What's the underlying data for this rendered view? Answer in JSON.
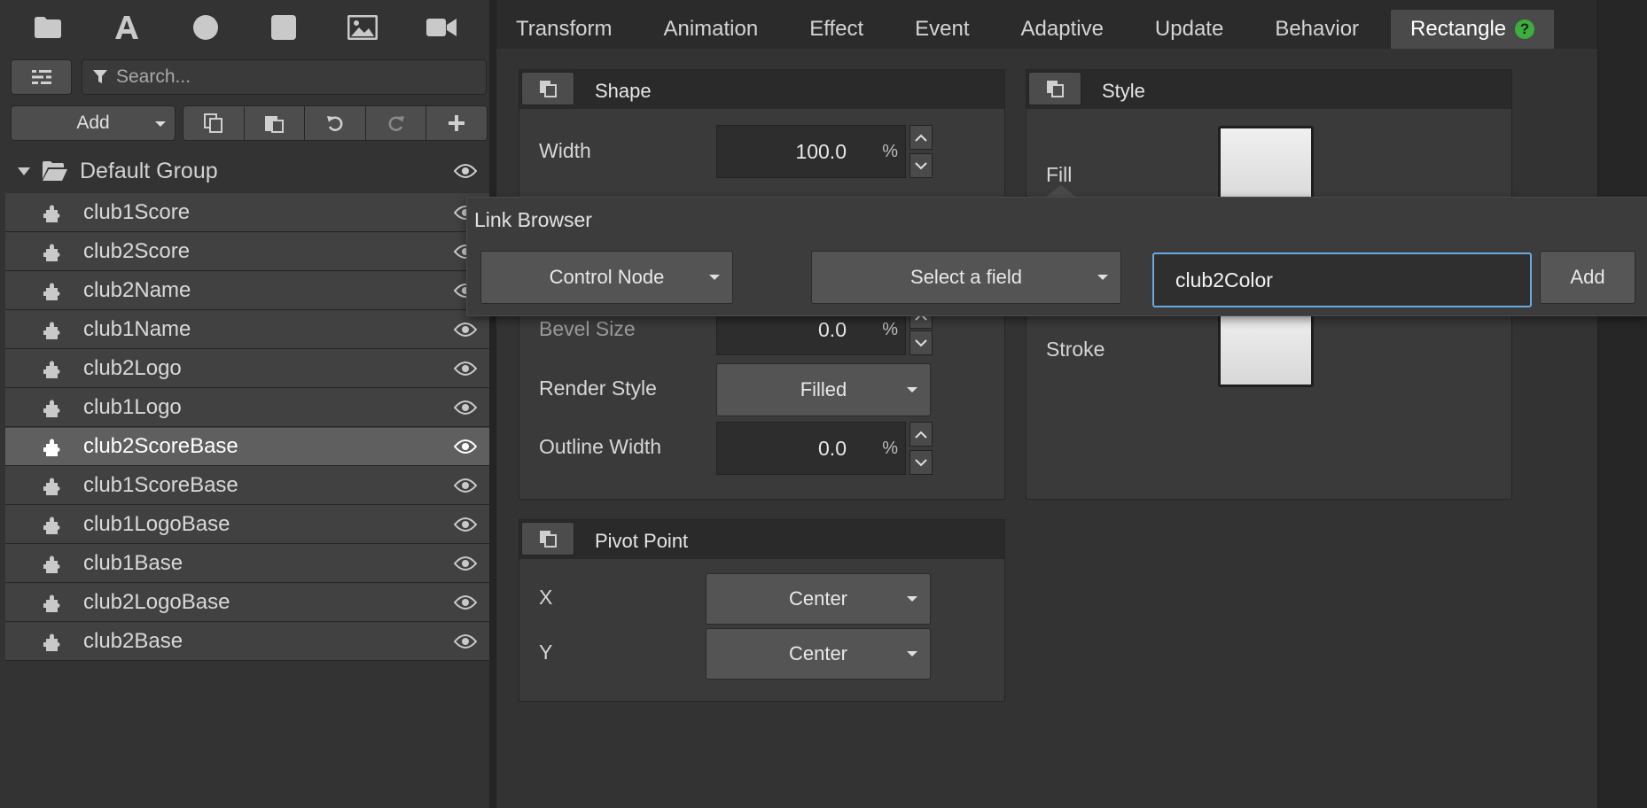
{
  "toolbar": {
    "icons": [
      "folder-icon",
      "text-icon",
      "circle-icon",
      "square-icon",
      "image-icon",
      "video-icon"
    ]
  },
  "search": {
    "placeholder": "Search..."
  },
  "controls": {
    "add_label": "Add"
  },
  "group": {
    "label": "Default Group"
  },
  "layers": [
    "club1Score",
    "club2Score",
    "club2Name",
    "club1Name",
    "club2Logo",
    "club1Logo",
    "club2ScoreBase",
    "club1ScoreBase",
    "club1LogoBase",
    "club1Base",
    "club2LogoBase",
    "club2Base"
  ],
  "selected_layer": "club2ScoreBase",
  "tabs": [
    "Transform",
    "Animation",
    "Effect",
    "Event",
    "Adaptive",
    "Update",
    "Behavior",
    "Rectangle"
  ],
  "active_tab": "Rectangle",
  "help_glyph": "?",
  "shape": {
    "title": "Shape",
    "width": {
      "label": "Width",
      "value": "100.0",
      "unit": "%"
    },
    "bevel": {
      "label": "Bevel Size",
      "value": "0.0",
      "unit": "%"
    },
    "render_style": {
      "label": "Render Style",
      "value": "Filled"
    },
    "outline_width": {
      "label": "Outline Width",
      "value": "0.0",
      "unit": "%"
    }
  },
  "style": {
    "title": "Style",
    "fill_label": "Fill",
    "stroke_label": "Stroke"
  },
  "pivot": {
    "title": "Pivot Point",
    "x_label": "X",
    "x_value": "Center",
    "y_label": "Y",
    "y_value": "Center"
  },
  "link_browser": {
    "title": "Link Browser",
    "node_select": "Control Node",
    "field_select": "Select a field",
    "input_value": "club2Color",
    "add_label": "Add"
  },
  "colors": {
    "accent_input_border": "#6aa9e0",
    "help_badge": "#3cae3c"
  }
}
